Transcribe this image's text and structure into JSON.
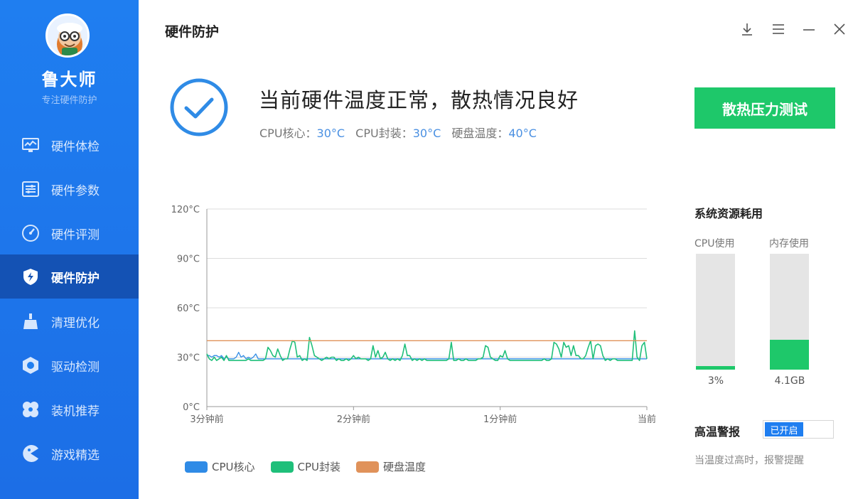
{
  "app": {
    "brand_name": "鲁大师",
    "slogan": "专注硬件防护"
  },
  "sidebar": {
    "items": [
      {
        "label": "硬件体检",
        "icon": "monitor-chart-icon",
        "active": false
      },
      {
        "label": "硬件参数",
        "icon": "list-settings-icon",
        "active": false
      },
      {
        "label": "硬件评测",
        "icon": "speedometer-icon",
        "active": false
      },
      {
        "label": "硬件防护",
        "icon": "shield-bolt-icon",
        "active": true
      },
      {
        "label": "清理优化",
        "icon": "broom-icon",
        "active": false
      },
      {
        "label": "驱动检测",
        "icon": "gear-hex-icon",
        "active": false
      },
      {
        "label": "装机推荐",
        "icon": "fan-icon",
        "active": false
      },
      {
        "label": "游戏精选",
        "icon": "pacman-icon",
        "active": false
      }
    ]
  },
  "header": {
    "title": "硬件防护",
    "window_controls": [
      "download-icon",
      "menu-icon",
      "minimize-icon",
      "close-icon"
    ]
  },
  "status": {
    "headline": "当前硬件温度正常，散热情况良好",
    "cpu_core_label": "CPU核心：",
    "cpu_core_value": "30°C",
    "cpu_package_label": "CPU封装：",
    "cpu_package_value": "30°C",
    "disk_label": "硬盘温度：",
    "disk_value": "40°C",
    "stress_test_label": "散热压力测试"
  },
  "chart_data": {
    "type": "line",
    "title": "",
    "xlabel": "",
    "ylabel": "",
    "ylim": [
      0,
      120
    ],
    "y_ticks": [
      "0°C",
      "30°C",
      "60°C",
      "90°C",
      "120°C"
    ],
    "x_ticks": [
      "3分钟前",
      "2分钟前",
      "1分钟前",
      "当前"
    ],
    "x_range": [
      0,
      180
    ],
    "grid": true,
    "legend_position": "bottom-left",
    "series": [
      {
        "name": "CPU核心",
        "color": "#2f8be6",
        "values": [
          31,
          31,
          30,
          31,
          31,
          30,
          31,
          29,
          30,
          29,
          29,
          29,
          30,
          33,
          30,
          31,
          29,
          30,
          29,
          30,
          32,
          29,
          29,
          29,
          29,
          29,
          29,
          29,
          29,
          29,
          29,
          29,
          29,
          29,
          29,
          29,
          29,
          29,
          29,
          29,
          29,
          29,
          29,
          29,
          29,
          29,
          29,
          29,
          29,
          29,
          29,
          29,
          29,
          29,
          29,
          29,
          29,
          29,
          29,
          29,
          29,
          29,
          29,
          29,
          29,
          29,
          29,
          29,
          29,
          29,
          29,
          29,
          29,
          29,
          29,
          29,
          29,
          29,
          29,
          29,
          29,
          29,
          29,
          29,
          29,
          29,
          29,
          29,
          29,
          29,
          29,
          29,
          29,
          29,
          29,
          29,
          29,
          29,
          29,
          29,
          29,
          29,
          29,
          29,
          29,
          29,
          29,
          29,
          29,
          29,
          29,
          29,
          29,
          29,
          29,
          29,
          29,
          29,
          29,
          29,
          29,
          29,
          29,
          29,
          29,
          29,
          29,
          29,
          29,
          29,
          29,
          29,
          29,
          29,
          29,
          29,
          29,
          29,
          29,
          29,
          29,
          29,
          29,
          29,
          29,
          29,
          29,
          29,
          29,
          29,
          29,
          29,
          29,
          29,
          29,
          29,
          29,
          29,
          29,
          29,
          29,
          29,
          29,
          29,
          29,
          29,
          29,
          29,
          29,
          29,
          29,
          29,
          29,
          29,
          29,
          29,
          29,
          29,
          29,
          29,
          29
        ]
      },
      {
        "name": "CPU封装",
        "color": "#1fbf7a",
        "values": [
          32,
          29,
          28,
          30,
          28,
          29,
          30,
          28,
          31,
          28,
          28,
          28,
          28,
          28,
          28,
          28,
          28,
          29,
          28,
          28,
          28,
          28,
          28,
          28,
          29,
          36,
          34,
          31,
          30,
          35,
          31,
          28,
          29,
          29,
          35,
          40,
          39,
          30,
          31,
          28,
          29,
          28,
          42,
          37,
          31,
          30,
          29,
          28,
          29,
          30,
          29,
          30,
          30,
          28,
          29,
          28,
          28,
          29,
          28,
          29,
          31,
          29,
          30,
          29,
          29,
          29,
          28,
          29,
          37,
          30,
          34,
          29,
          30,
          33,
          29,
          28,
          29,
          28,
          29,
          28,
          31,
          38,
          31,
          31,
          28,
          29,
          28,
          29,
          28,
          29,
          28,
          28,
          28,
          28,
          28,
          28,
          28,
          28,
          28,
          29,
          39,
          28,
          28,
          29,
          28,
          28,
          29,
          28,
          28,
          28,
          28,
          29,
          29,
          30,
          37,
          36,
          30,
          29,
          28,
          28,
          31,
          30,
          34,
          29,
          28,
          28,
          28,
          28,
          28,
          28,
          28,
          28,
          28,
          28,
          28,
          28,
          28,
          28,
          29,
          28,
          28,
          29,
          39,
          38,
          35,
          30,
          39,
          36,
          37,
          31,
          37,
          31,
          31,
          29,
          29,
          31,
          36,
          40,
          29,
          37,
          38,
          37,
          31,
          28,
          29,
          28,
          29,
          29,
          28,
          28,
          28,
          28,
          28,
          28,
          28,
          46,
          30,
          28,
          37,
          39,
          29
        ]
      },
      {
        "name": "硬盘温度",
        "color": "#e0925a",
        "values": [
          40,
          40,
          40,
          40,
          40,
          40,
          40,
          40,
          40,
          40,
          40,
          40,
          40,
          40,
          40,
          40,
          40,
          40,
          40,
          40,
          40,
          40,
          40,
          40,
          40,
          40,
          40,
          40,
          40,
          40,
          40,
          40,
          40,
          40,
          40,
          40,
          40,
          40,
          40,
          40,
          40,
          40,
          40,
          40,
          40,
          40,
          40,
          40,
          40,
          40,
          40,
          40,
          40,
          40,
          40,
          40,
          40,
          40,
          40,
          40,
          40,
          40,
          40,
          40,
          40,
          40,
          40,
          40,
          40,
          40,
          40,
          40,
          40,
          40,
          40,
          40,
          40,
          40,
          40,
          40,
          40,
          40,
          40,
          40,
          40,
          40,
          40,
          40,
          40,
          40,
          40,
          40,
          40,
          40,
          40,
          40,
          40,
          40,
          40,
          40,
          40,
          40,
          40,
          40,
          40,
          40,
          40,
          40,
          40,
          40,
          40,
          40,
          40,
          40,
          40,
          40,
          40,
          40,
          40,
          40,
          40,
          40,
          40,
          40,
          40,
          40,
          40,
          40,
          40,
          40,
          40,
          40,
          40,
          40,
          40,
          40,
          40,
          40,
          40,
          40,
          40,
          40,
          40,
          40,
          40,
          40,
          40,
          40,
          40,
          40,
          40,
          40,
          40,
          40,
          40,
          40,
          40,
          40,
          40,
          40,
          40,
          40,
          40,
          40,
          40,
          40,
          40,
          40,
          40,
          40,
          40,
          40,
          40,
          40,
          40,
          40,
          40,
          40,
          40,
          40,
          40
        ]
      }
    ]
  },
  "resources": {
    "title": "系统资源耗用",
    "cpu_label": "CPU使用",
    "cpu_value": "3%",
    "cpu_fraction": 0.03,
    "mem_label": "内存使用",
    "mem_value": "4.1GB",
    "mem_fraction": 0.26,
    "fill_color": "#1ec86a"
  },
  "alarm": {
    "label": "高温警报",
    "toggle_label": "已开启",
    "description": "当温度过高时，报警提醒"
  }
}
